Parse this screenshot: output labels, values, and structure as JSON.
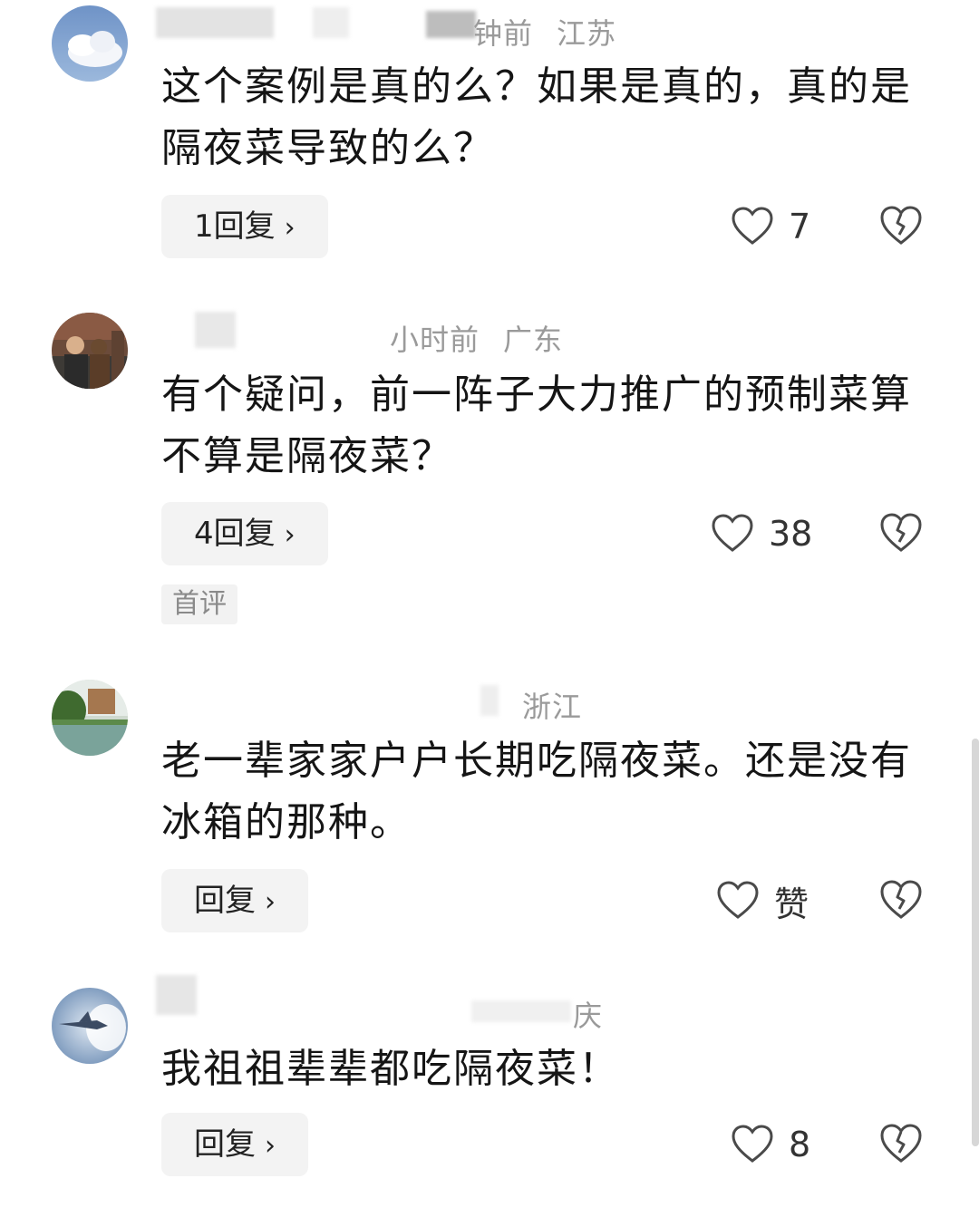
{
  "comments": [
    {
      "time_location": "钟前",
      "location": "江苏",
      "text": "这个案例是真的么？如果是真的，真的是隔夜菜导致的么？",
      "reply_label": "1回复",
      "like_label": "7",
      "avatar_icon": "cloud-avatar"
    },
    {
      "time_location": "小时前",
      "location": "广东",
      "text": "有个疑问，前一阵子大力推广的预制菜算不算是隔夜菜？",
      "reply_label": "4回复",
      "like_label": "38",
      "badge": "首评",
      "avatar_icon": "person-avatar"
    },
    {
      "time_location": "",
      "location": "浙江",
      "text": "老一辈家家户户长期吃隔夜菜。还是没有冰箱的那种。",
      "reply_label": "回复",
      "like_label": "赞",
      "avatar_icon": "landscape-avatar"
    },
    {
      "time_location": "",
      "location": "庆",
      "text": "我祖祖辈辈都吃隔夜菜！",
      "reply_label": "回复",
      "like_label": "8",
      "avatar_icon": "jet-avatar"
    }
  ],
  "icons": {
    "like": "heart-outline-icon",
    "dislike": "broken-heart-icon",
    "chevron": "chevron-right-icon"
  },
  "colors": {
    "meta_text": "#9a9a9a",
    "body_text": "#151515",
    "button_bg": "#f3f3f3"
  }
}
